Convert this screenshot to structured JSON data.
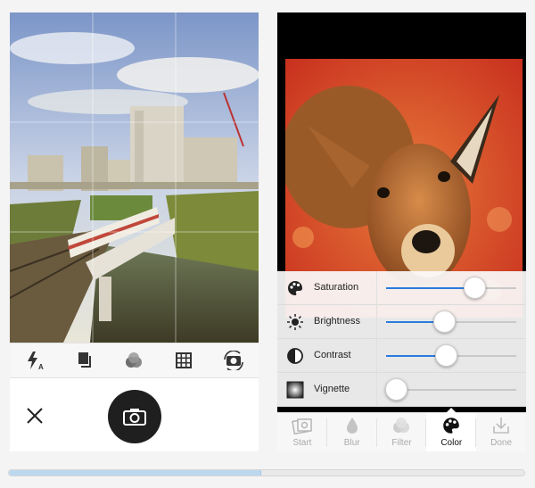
{
  "camera": {
    "toolbar_icons": [
      "flash-auto-icon",
      "crop-icon",
      "filter-circles-icon",
      "grid-icon",
      "switch-camera-icon"
    ],
    "flash_label": "A",
    "close_icon": "close-icon",
    "shutter_icon": "camera-icon"
  },
  "editor": {
    "adjustments": [
      {
        "label": "Saturation",
        "icon": "palette-icon",
        "level": 0.68
      },
      {
        "label": "Brightness",
        "icon": "sun-icon",
        "level": 0.45
      },
      {
        "label": "Contrast",
        "icon": "contrast-icon",
        "level": 0.46
      },
      {
        "label": "Vignette",
        "icon": "vignette-icon",
        "level": 0.08
      }
    ],
    "tabs": [
      {
        "label": "Start",
        "icon": "photos-icon",
        "active": false
      },
      {
        "label": "Blur",
        "icon": "drop-icon",
        "active": false
      },
      {
        "label": "Filter",
        "icon": "filter-circles-icon",
        "active": false
      },
      {
        "label": "Color",
        "icon": "palette-icon",
        "active": true
      },
      {
        "label": "Done",
        "icon": "download-icon",
        "active": false
      }
    ]
  },
  "progress": {
    "level": 0.49
  },
  "colors": {
    "accent": "#2a7be0",
    "shutter": "#1f1f1f",
    "toolbar_bg": "#f7f7f7"
  }
}
